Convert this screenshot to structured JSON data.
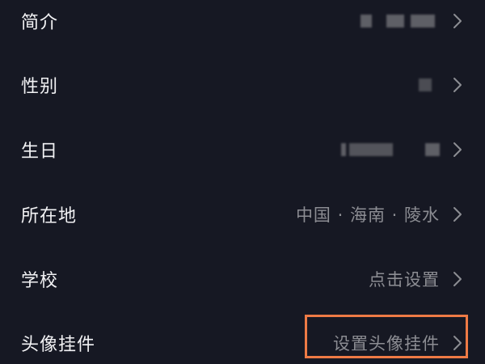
{
  "profile_fields": [
    {
      "label": "简介",
      "value": ""
    },
    {
      "label": "性别",
      "value": ""
    },
    {
      "label": "生日",
      "value": ""
    },
    {
      "label": "所在地",
      "value": "中国 · 海南 · 陵水"
    },
    {
      "label": "学校",
      "value": "点击设置"
    },
    {
      "label": "头像挂件",
      "value": "设置头像挂件"
    }
  ],
  "icons": {
    "chevron": "chevron-right-icon"
  },
  "colors": {
    "background": "#161823",
    "label_text": "#f2f2f4",
    "value_text": "#8c8d93",
    "highlight_border": "#ee7a45"
  }
}
